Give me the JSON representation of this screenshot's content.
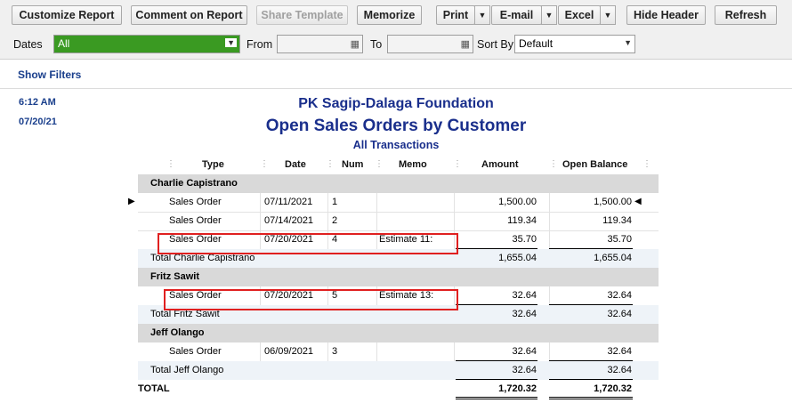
{
  "toolbar": {
    "customize": "Customize Report",
    "comment": "Comment on Report",
    "share": "Share Template",
    "memorize": "Memorize",
    "print": "Print",
    "email": "E-mail",
    "excel": "Excel",
    "hide_header": "Hide Header",
    "refresh": "Refresh",
    "arrow": "▼"
  },
  "filters": {
    "dates_label": "Dates",
    "dates_value": "All",
    "from_label": "From",
    "from_value": "",
    "to_label": "To",
    "to_value": "",
    "sortby_label": "Sort By",
    "sortby_value": "Default"
  },
  "show_filters": "Show Filters",
  "report": {
    "time": "6:12 AM",
    "date": "07/20/21",
    "company": "PK Sagip-Dalaga Foundation",
    "title": "Open Sales Orders by Customer",
    "subtitle": "All Transactions"
  },
  "columns": [
    "Type",
    "Date",
    "Num",
    "Memo",
    "Amount",
    "Open Balance"
  ],
  "rows": {
    "g1": "Charlie Capistrano",
    "r1": {
      "type": "Sales Order",
      "date": "07/11/2021",
      "num": "1",
      "memo": "",
      "amount": "1,500.00",
      "open": "1,500.00"
    },
    "r2": {
      "type": "Sales Order",
      "date": "07/14/2021",
      "num": "2",
      "memo": "",
      "amount": "119.34",
      "open": "119.34"
    },
    "r3": {
      "type": "Sales Order",
      "date": "07/20/2021",
      "num": "4",
      "memo": "Estimate 11:",
      "amount": "35.70",
      "open": "35.70"
    },
    "t1": {
      "label": "Total Charlie Capistrano",
      "amount": "1,655.04",
      "open": "1,655.04"
    },
    "g2": "Fritz Sawit",
    "r4": {
      "type": "Sales Order",
      "date": "07/20/2021",
      "num": "5",
      "memo": "Estimate 13:",
      "amount": "32.64",
      "open": "32.64"
    },
    "t2": {
      "label": "Total Fritz Sawit",
      "amount": "32.64",
      "open": "32.64"
    },
    "g3": "Jeff Olango",
    "r5": {
      "type": "Sales Order",
      "date": "06/09/2021",
      "num": "3",
      "memo": "",
      "amount": "32.64",
      "open": "32.64"
    },
    "t3": {
      "label": "Total Jeff Olango",
      "amount": "32.64",
      "open": "32.64"
    },
    "total": {
      "label": "TOTAL",
      "amount": "1,720.32",
      "open": "1,720.32"
    }
  },
  "colors": {
    "accent": "#1a2f8c",
    "highlight_box": "#e02020",
    "dates_bg": "#3a9a22"
  }
}
